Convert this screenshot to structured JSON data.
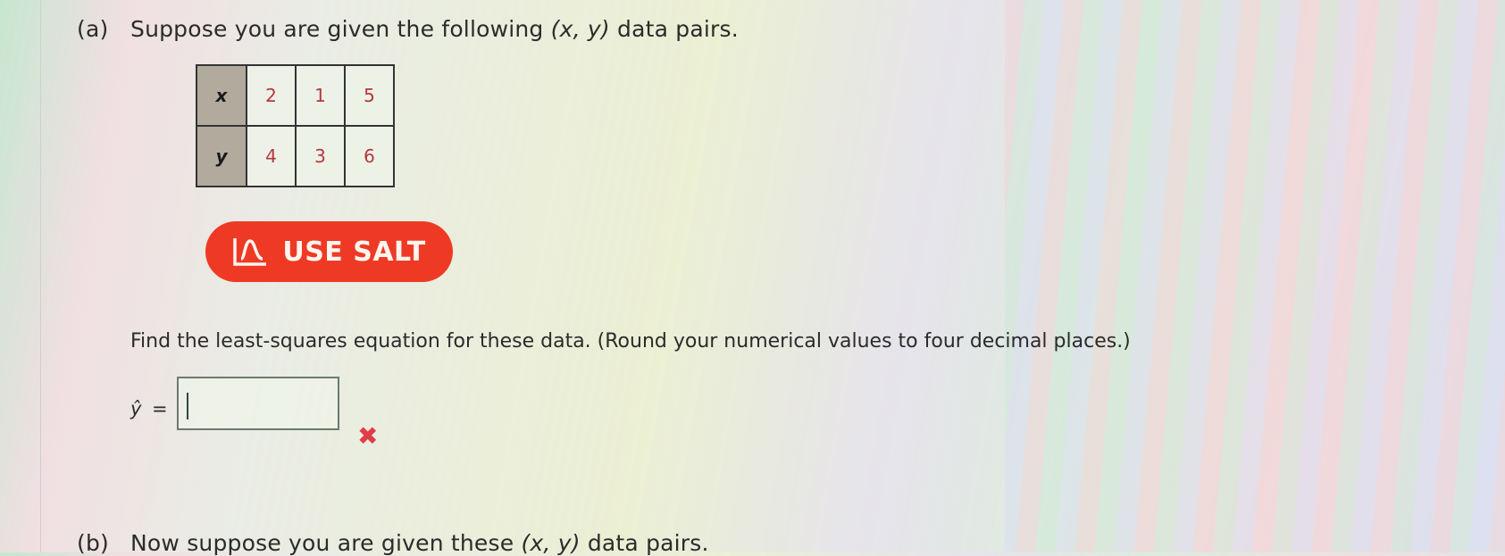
{
  "part_a": {
    "label": "(a)",
    "prompt_before": "Suppose you are given the following ",
    "prompt_vars": "(x, y)",
    "prompt_after": " data pairs.",
    "table": {
      "x_header": "x",
      "y_header": "y",
      "x_values": [
        "2",
        "1",
        "5"
      ],
      "y_values": [
        "4",
        "3",
        "6"
      ]
    },
    "salt_button_label": "USE SALT",
    "instruction": "Find the least-squares equation for these data. (Round your numerical values to four decimal places.)",
    "answer_label_var": "ŷ",
    "answer_label_eq": "=",
    "answer_value": "",
    "status": "incorrect"
  },
  "part_b": {
    "label": "(b)",
    "prompt_before": "Now suppose you are given these ",
    "prompt_vars": "(x, y)",
    "prompt_after": " data pairs."
  },
  "colors": {
    "salt_button": "#ee3a24",
    "incorrect_mark": "#e03c4a",
    "table_value": "#b5383f",
    "table_header_bg": "#b2aa9c"
  }
}
